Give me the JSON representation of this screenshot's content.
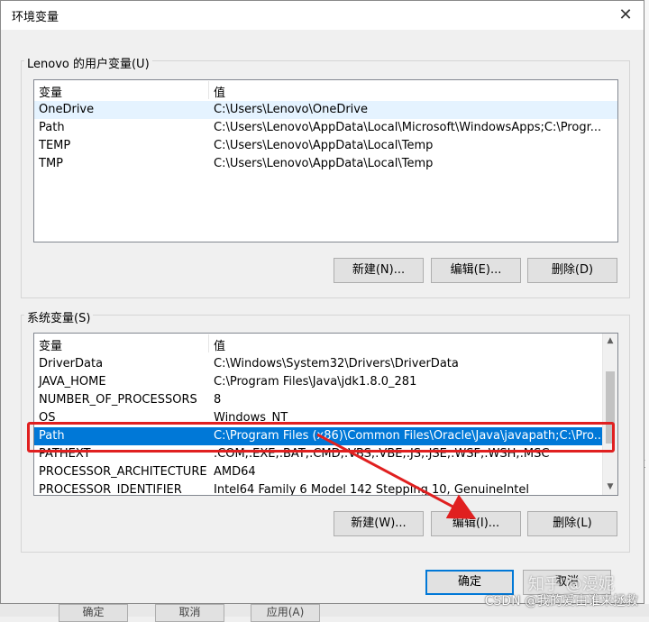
{
  "window": {
    "title": "环境变量",
    "close_glyph": "✕"
  },
  "user_group": {
    "label": "Lenovo 的用户变量(U)",
    "columns": [
      "变量",
      "值"
    ],
    "rows": [
      {
        "name": "OneDrive",
        "value": "C:\\Users\\Lenovo\\OneDrive"
      },
      {
        "name": "Path",
        "value": "C:\\Users\\Lenovo\\AppData\\Local\\Microsoft\\WindowsApps;C:\\Progr..."
      },
      {
        "name": "TEMP",
        "value": "C:\\Users\\Lenovo\\AppData\\Local\\Temp"
      },
      {
        "name": "TMP",
        "value": "C:\\Users\\Lenovo\\AppData\\Local\\Temp"
      }
    ],
    "buttons": {
      "new": "新建(N)...",
      "edit": "编辑(E)...",
      "delete": "删除(D)"
    }
  },
  "system_group": {
    "label": "系统变量(S)",
    "columns": [
      "变量",
      "值"
    ],
    "rows": [
      {
        "name": "DriverData",
        "value": "C:\\Windows\\System32\\Drivers\\DriverData"
      },
      {
        "name": "JAVA_HOME",
        "value": "C:\\Program Files\\Java\\jdk1.8.0_281"
      },
      {
        "name": "NUMBER_OF_PROCESSORS",
        "value": "8"
      },
      {
        "name": "OS",
        "value": "Windows_NT"
      },
      {
        "name": "Path",
        "value": "C:\\Program Files (x86)\\Common Files\\Oracle\\Java\\javapath;C:\\Pro..."
      },
      {
        "name": "PATHEXT",
        "value": ".COM;.EXE;.BAT;.CMD;.VBS;.VBE;.JS;.JSE;.WSF;.WSH;.MSC"
      },
      {
        "name": "PROCESSOR_ARCHITECTURE",
        "value": "AMD64"
      },
      {
        "name": "PROCESSOR_IDENTIFIER",
        "value": "Intel64 Family 6 Model 142 Stepping 10, GenuineIntel"
      }
    ],
    "selected_row": "Path",
    "buttons": {
      "new": "新建(W)...",
      "edit": "编辑(I)...",
      "delete": "删除(L)"
    }
  },
  "footer": {
    "ok": "确定",
    "cancel": "取消"
  },
  "background": {
    "left_glyphs": [
      "/",
      "c",
      "必",
      "剂",
      "面"
    ],
    "right_glyphs": [
      ".x",
      "注"
    ],
    "bottom_buttons": [
      "确定",
      "取消",
      "应用(A)"
    ]
  },
  "watermarks": {
    "zhihu": "知乎 @漫妮",
    "csdn": "CSDN @我的爱由谁来拯救"
  },
  "annotation": {
    "highlight_color": "#e02020"
  },
  "colors": {
    "selection": "#0078d7",
    "hover": "#e5f3ff"
  }
}
